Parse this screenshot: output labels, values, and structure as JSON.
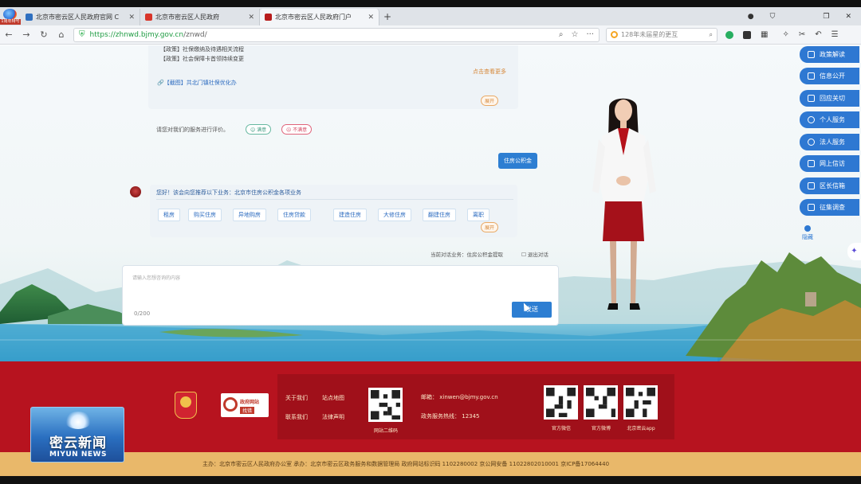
{
  "browser": {
    "tabs": [
      {
        "title": "北京市密云区人民政府官网 C",
        "active": false
      },
      {
        "title": "北京市密云区人民政府",
        "active": false
      },
      {
        "title": "北京市密云区人民政府门户",
        "active": true
      }
    ],
    "badge": "1周年特号",
    "new_tab": "+",
    "url_domain": "https://zhnwd.bjmy.gov.cn",
    "url_path": "/znwd/",
    "search_placeholder": "128年未届星的更互",
    "more_dots": "···"
  },
  "chat": {
    "prev_lines": [
      "【政策】社保缴纳及待遇相关流程",
      "【政策】社会保障卡首领持续变更"
    ],
    "more_link": "点击查看更多",
    "policy_link": "【截图】共北门镇社保优化办",
    "expand_label": "展开",
    "rate_prompt": "请您对我们的服务进行评价。",
    "rate_good": "满意",
    "rate_bad": "不满意",
    "user_message": "住房公积金",
    "bot_intro": "您好！该会向您推荐以下业务：北京市住房公积金各项业务",
    "options": [
      "租房",
      "购买住房",
      "异地购房",
      "住房贷款",
      "建造住房",
      "大修住房",
      "翻建住房",
      "离职"
    ],
    "expand_label2": "展开",
    "topic_status": "当前对话业务：住房公积金提取",
    "exit_topic": "退出对话",
    "input_placeholder": "请输入您想咨询的内容",
    "char_count": "0/200",
    "send_label": "发送"
  },
  "right_nav": {
    "items": [
      "政策解读",
      "信息公开",
      "回应关切",
      "个人服务",
      "法人服务",
      "网上信访",
      "区长信箱",
      "征集调查"
    ],
    "collapse_label": "隐藏"
  },
  "footer": {
    "links": [
      "关于我们",
      "站点地图",
      "联系我们",
      "法律声明"
    ],
    "jiucuo_line1": "政府网站",
    "jiucuo_line2": "找错",
    "site_qr_label": "网站二维码",
    "email_label": "邮箱：",
    "email": "xinwen@bjmy.gov.cn",
    "hotline_label": "政务服务热线：",
    "hotline": "12345",
    "qr_labels": [
      "官方微信",
      "官方微博",
      "北京密云app"
    ],
    "bottom_text": "主办：北京市密云区人民政府办公室   承办：北京市密云区政务服务和数据管理局   政府网站标识码 1102280002   京公网安备 11022802010001   京ICP备17064440"
  },
  "tv_logo": {
    "cn": "密云新闻",
    "en": "MIYUN NEWS"
  },
  "colors": {
    "primary_blue": "#2e78d2",
    "footer_red": "#b7131f",
    "footer_gold": "#e9b86a",
    "url_green": "#1f9c43"
  }
}
